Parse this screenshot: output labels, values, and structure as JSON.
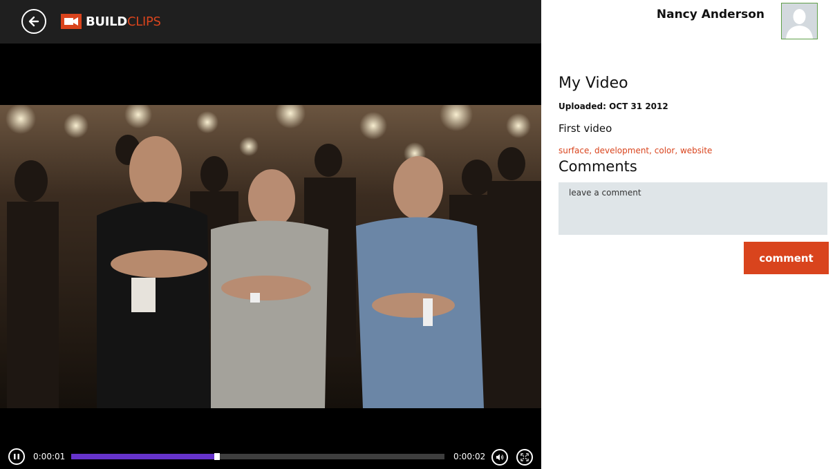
{
  "app": {
    "brand_part1": "BUILD",
    "brand_part2": "CLIPS",
    "accent_color": "#d9441d"
  },
  "icons": {
    "back": "arrow-left-icon",
    "logo": "video-camera-icon",
    "play_pause": "pause-icon",
    "volume": "speaker-icon",
    "fullscreen": "fullscreen-icon",
    "avatar": "person-silhouette-icon"
  },
  "player": {
    "current_time": "0:00:01",
    "total_time": "0:00:02",
    "progress_fraction": 0.385,
    "progress_color": "#6633cc"
  },
  "user": {
    "name": "Nancy Anderson"
  },
  "video": {
    "title": "My Video",
    "uploaded": "Uploaded: OCT 31 2012",
    "description": "First video",
    "tags": "surface, development, color, website"
  },
  "comments": {
    "heading": "Comments",
    "input_placeholder": "leave a comment",
    "input_value": "",
    "submit_label": "comment"
  }
}
